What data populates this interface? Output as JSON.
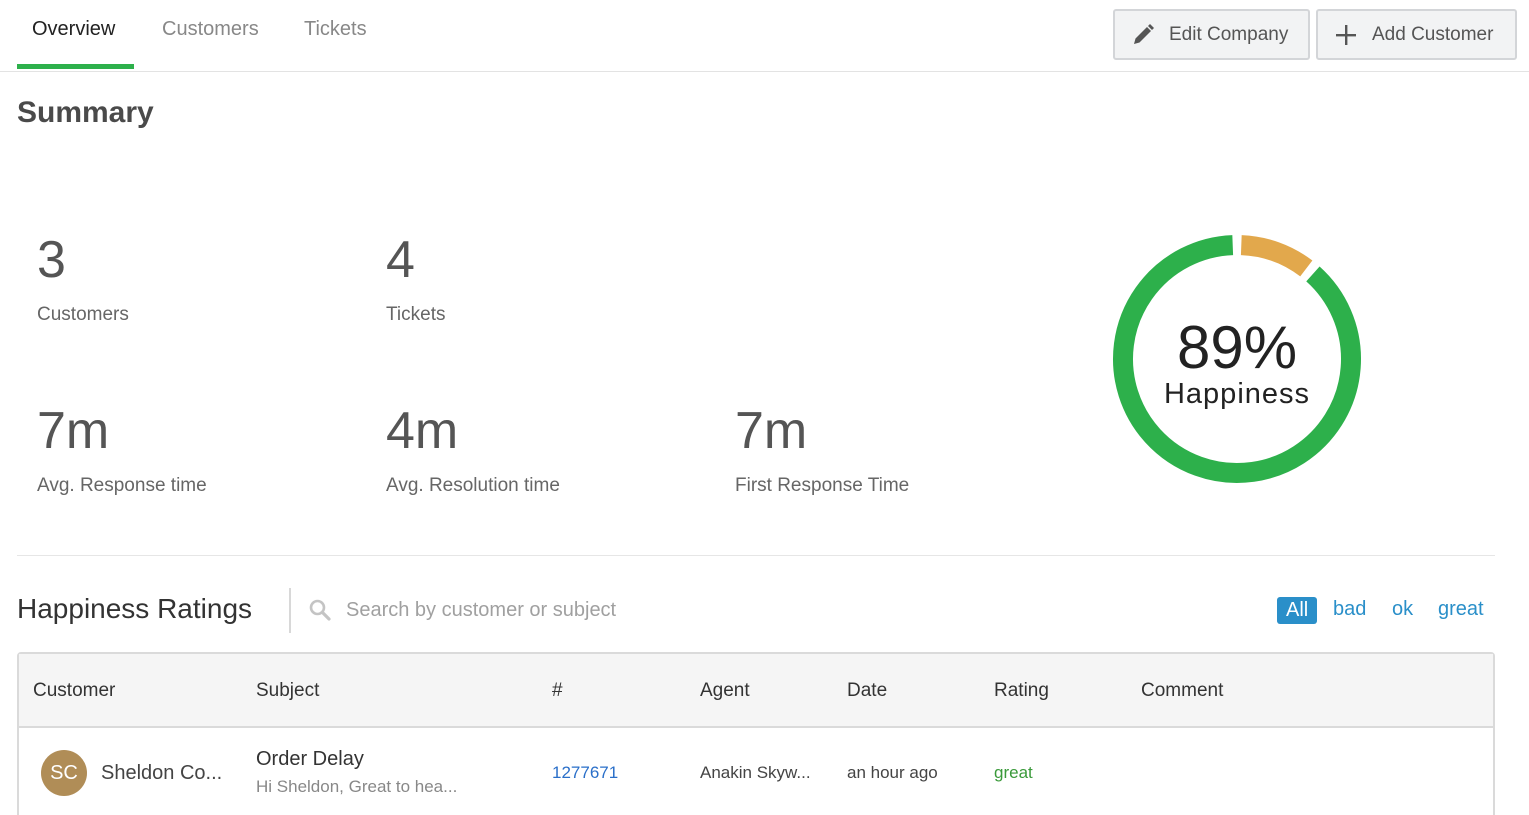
{
  "tabs": [
    {
      "label": "Overview",
      "active": true
    },
    {
      "label": "Customers",
      "active": false
    },
    {
      "label": "Tickets",
      "active": false
    }
  ],
  "actions": {
    "edit_company": "Edit Company",
    "add_customer": "Add Customer"
  },
  "summary": {
    "title": "Summary",
    "stats": [
      {
        "value": "3",
        "label": "Customers"
      },
      {
        "value": "4",
        "label": "Tickets"
      },
      {
        "value": "7m",
        "label": "Avg. Response time"
      },
      {
        "value": "4m",
        "label": "Avg. Resolution time"
      },
      {
        "value": "7m",
        "label": "First Response Time"
      }
    ],
    "happiness": {
      "percent_text": "89%",
      "label": "Happiness",
      "great_fraction": 0.89,
      "ok_fraction": 0.11,
      "great_color": "#2db04b",
      "ok_color": "#e2a84c"
    }
  },
  "ratings": {
    "title": "Happiness Ratings",
    "search_placeholder": "Search by customer or subject",
    "filters": [
      {
        "label": "All",
        "active": true
      },
      {
        "label": "bad",
        "active": false
      },
      {
        "label": "ok",
        "active": false
      },
      {
        "label": "great",
        "active": false
      }
    ],
    "columns": [
      "Customer",
      "Subject",
      "#",
      "Agent",
      "Date",
      "Rating",
      "Comment"
    ],
    "rows": [
      {
        "initials": "SC",
        "customer": "Sheldon Co...",
        "subject": "Order Delay",
        "snippet": "Hi Sheldon, Great to hea...",
        "ticket": "1277671",
        "agent": "Anakin Skyw...",
        "date": "an hour ago",
        "rating": "great",
        "comment": ""
      }
    ]
  },
  "colors": {
    "accent_green": "#2db04b",
    "link_blue": "#2a8fc9",
    "rating_great": "#3a9a3a"
  }
}
